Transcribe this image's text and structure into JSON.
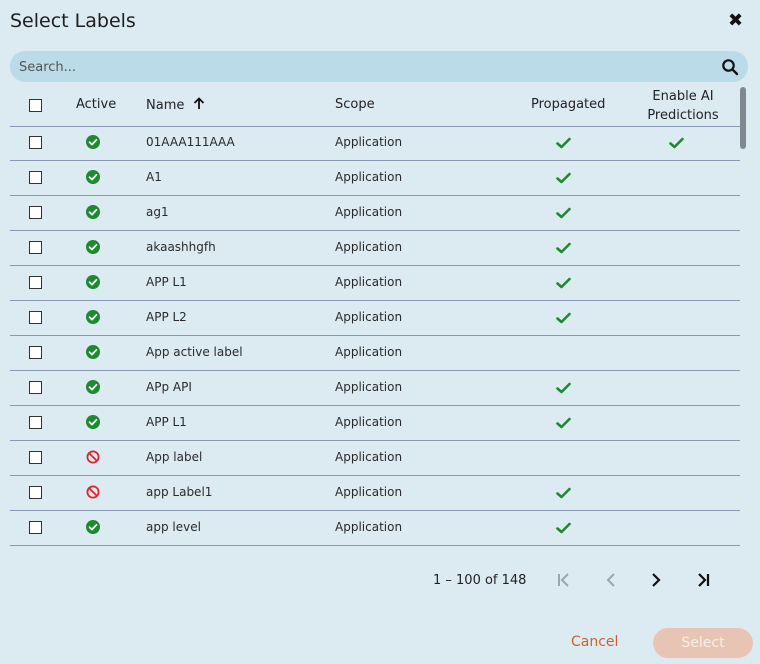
{
  "dialog": {
    "title": "Select Labels",
    "search_placeholder": "Search...",
    "search_value": ""
  },
  "columns": {
    "active": "Active",
    "name": "Name",
    "scope": "Scope",
    "propagated": "Propagated",
    "enable_ai_line1": "Enable AI",
    "enable_ai_line2": "Predictions"
  },
  "sort": {
    "column": "name",
    "direction": "ascending"
  },
  "rows": [
    {
      "name": "01AAA111AAA",
      "scope": "Application",
      "active": true,
      "propagated": true,
      "ai": true
    },
    {
      "name": "A1",
      "scope": "Application",
      "active": true,
      "propagated": true,
      "ai": false
    },
    {
      "name": "ag1",
      "scope": "Application",
      "active": true,
      "propagated": true,
      "ai": false
    },
    {
      "name": "akaashhgfh",
      "scope": "Application",
      "active": true,
      "propagated": true,
      "ai": false
    },
    {
      "name": "APP L1",
      "scope": "Application",
      "active": true,
      "propagated": true,
      "ai": false
    },
    {
      "name": "APP L2",
      "scope": "Application",
      "active": true,
      "propagated": true,
      "ai": false
    },
    {
      "name": "App active label",
      "scope": "Application",
      "active": true,
      "propagated": false,
      "ai": false
    },
    {
      "name": "APp API",
      "scope": "Application",
      "active": true,
      "propagated": true,
      "ai": false
    },
    {
      "name": "APP L1",
      "scope": "Application",
      "active": true,
      "propagated": true,
      "ai": false
    },
    {
      "name": "App label",
      "scope": "Application",
      "active": false,
      "propagated": false,
      "ai": false
    },
    {
      "name": "app Label1",
      "scope": "Application",
      "active": false,
      "propagated": true,
      "ai": false
    },
    {
      "name": "app level",
      "scope": "Application",
      "active": true,
      "propagated": true,
      "ai": false
    }
  ],
  "pagination": {
    "range_text": "1 – 100 of 148"
  },
  "footer": {
    "cancel_label": "Cancel",
    "select_label": "Select"
  },
  "colors": {
    "active_green": "#1e8a2f",
    "inactive_red": "#e0242c",
    "accent": "#c8622e"
  }
}
